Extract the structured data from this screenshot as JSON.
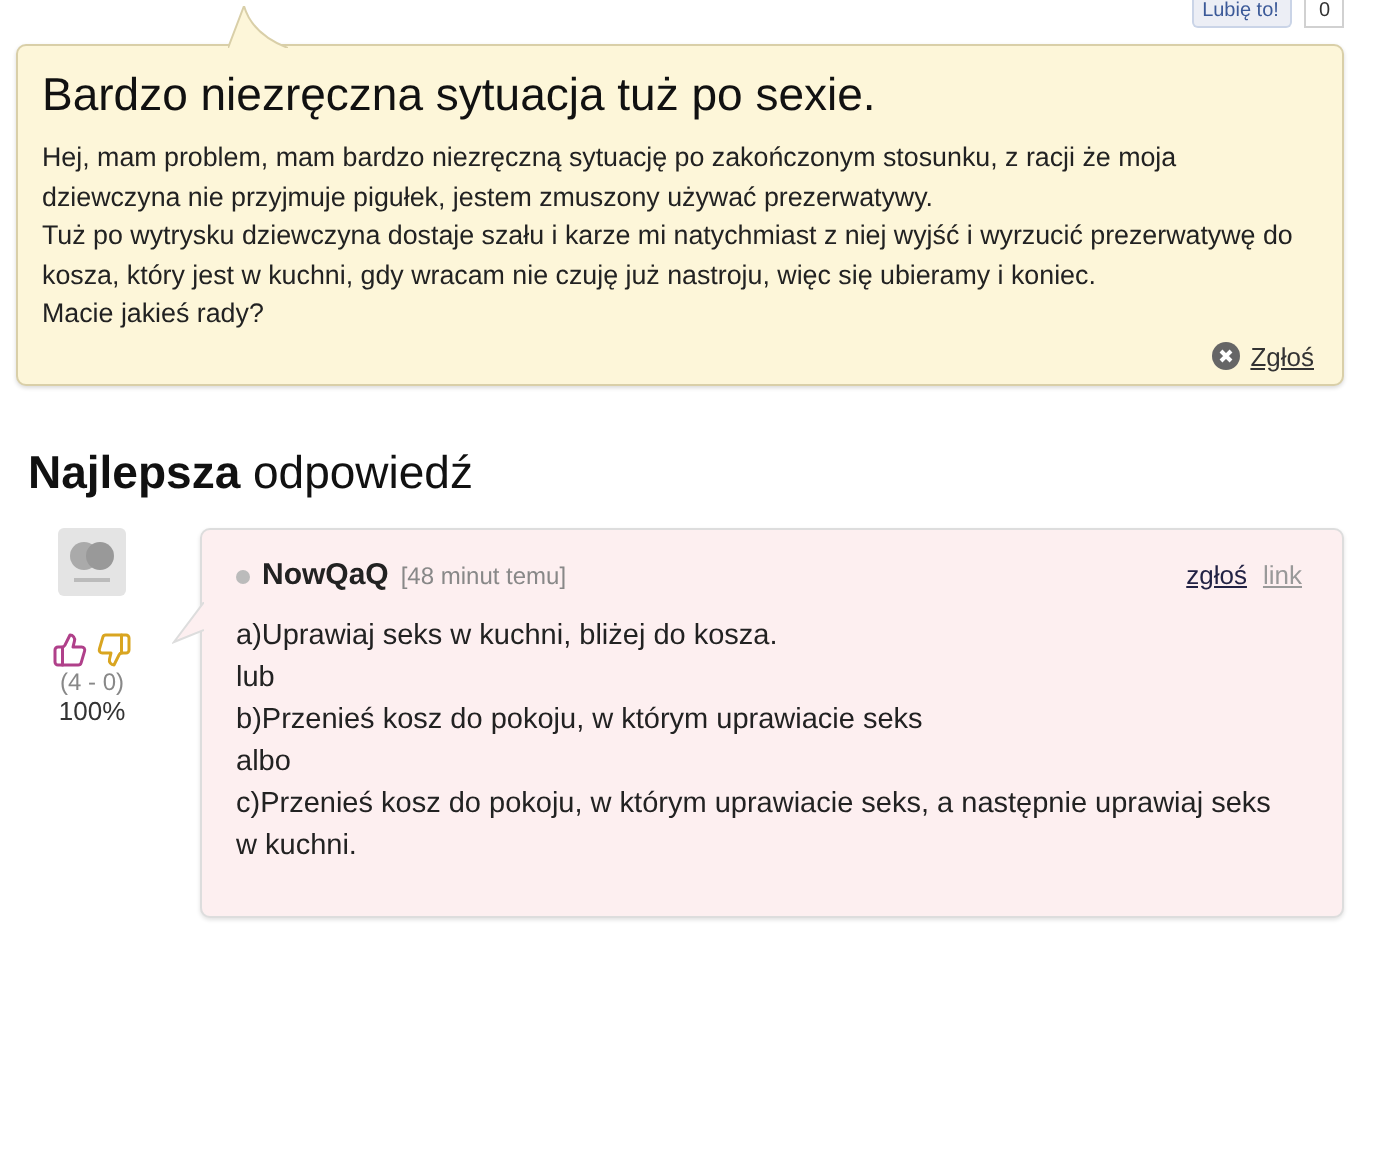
{
  "like_widget": {
    "label": "Lubię to!",
    "count": "0"
  },
  "question": {
    "title": "Bardzo niezręczna sytuacja tuż po sexie.",
    "paragraphs": [
      "Hej, mam problem, mam bardzo niezręczną sytuację po zakończonym stosunku, z racji że moja dziewczyna nie przyjmuje pigułek, jestem zmuszony używać prezerwatywy.",
      "Tuż po wytrysku dziewczyna dostaje szału i karze mi natychmiast z niej wyjść i wyrzucić prezerwatywę do kosza, który jest w kuchni, gdy wracam nie czuję już nastroju, więc się ubieramy i koniec.",
      "Macie jakieś rady?"
    ],
    "report": "Zgłoś"
  },
  "best_answer": {
    "heading_bold": "Najlepsza",
    "heading_rest": "odpowiedź",
    "votes": "(4 - 0)",
    "percent": "100%",
    "author": "NowQaQ",
    "time": "[48 minut temu]",
    "report": "zgłoś",
    "link": "link",
    "lines": [
      "a)Uprawiaj seks w kuchni, bliżej do kosza.",
      "lub",
      "b)Przenieś kosz do pokoju, w którym uprawiacie seks",
      "albo",
      "c)Przenieś kosz do pokoju, w którym uprawiacie seks, a następnie uprawiaj seks w kuchni."
    ]
  }
}
